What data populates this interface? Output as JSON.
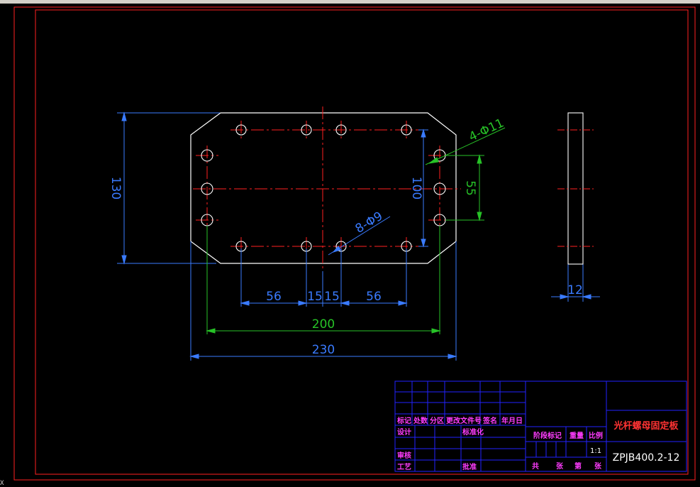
{
  "colors": {
    "background": "#000000",
    "border": "#ff2020",
    "part": "#ffffff",
    "center": "#ff2020",
    "dimension": "#3a7bff",
    "dimension_alt": "#27c227",
    "titleblock": "#2222ff"
  },
  "dimensions": {
    "height_130": "130",
    "height_100": "100",
    "pitch_55": "55",
    "hole_11": "4-Φ11",
    "hole_9": "8-Φ9",
    "spacing_56_left": "56",
    "spacing_15_left": "15",
    "spacing_15_right": "15",
    "spacing_56_right": "56",
    "width_200": "200",
    "width_230": "230",
    "thickness_12": "12"
  },
  "title_block": {
    "labels": {
      "mark": "标记",
      "count": "处数",
      "zone": "分区",
      "change_doc": "更改文件号",
      "signature": "签名",
      "date": "年月日",
      "design": "设计",
      "standardize": "标准化",
      "stage_mark": "阶段标记",
      "weight": "重量",
      "scale": "比例",
      "review": "审核",
      "process": "工艺",
      "approve": "批准",
      "total": "共",
      "sheet": "张",
      "page_no": "第",
      "sheet2": "张"
    },
    "scale_value": "1:1",
    "part_name": "光杆螺母固定板",
    "drawing_code": "ZPJB400.2-12"
  },
  "command_line": "X"
}
